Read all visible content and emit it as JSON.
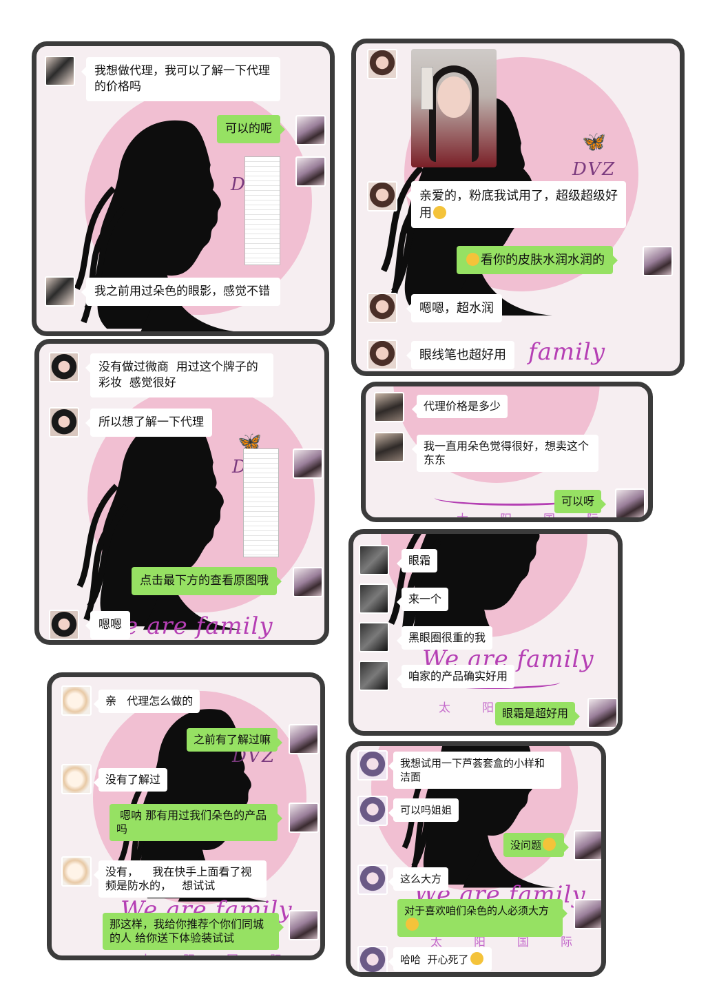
{
  "panel1": {
    "msg1": "我想做代理，我可以了解一下代理的价格吗",
    "reply1": "可以的呢",
    "msg2": "我之前用过朵色的眼影，感觉不错",
    "logo": "DVZ"
  },
  "panel2": {
    "msg1": "亲爱的，粉底我试用了，超级超级好用",
    "reply1": "看你的皮肤水润水润的",
    "msg2": "嗯嗯，超水润",
    "msg3": "眼线笔也超好用",
    "watermark": "family",
    "logo": "DVZ"
  },
  "panel3": {
    "msg1": "没有做过微商  用过这个牌子的彩妆  感觉很好",
    "msg2": "所以想了解一下代理",
    "reply1": "点击最下方的查看原图哦",
    "msg3": "嗯嗯",
    "watermark": "We are family",
    "logo": "D"
  },
  "panel4": {
    "msg1": "代理价格是多少",
    "msg2": "我一直用朵色觉得很好，想卖这个东东",
    "reply1": "可以呀",
    "watermark_cn": "太阳国际"
  },
  "panel5": {
    "msg1": "眼霜",
    "msg2": "来一个",
    "msg3": "黑眼圈很重的我",
    "msg4": "咱家的产品确实好用",
    "reply1": "眼霜是超好用",
    "watermark": "We are family",
    "watermark_cn": "太阳"
  },
  "panel6": {
    "msg1": "亲   代理怎么做的",
    "reply1": "之前有了解过嘛",
    "msg2": "没有了解过",
    "reply2": " 嗯呐 那有用过我们朵色的产品吗",
    "msg3": "没有，    我在快手上面看了视频是防水的，   想试试",
    "reply3": "那这样，我给你推荐个你们同城的人 给你送下体验装试试",
    "watermark": "We are family",
    "watermark_cn": "太阳国际",
    "logo": "DVZ"
  },
  "panel7": {
    "msg1": "我想试用一下芦荟套盒的小样和洁面",
    "msg2": "可以吗姐姐",
    "reply1": "没问题",
    "msg3": "这么大方",
    "reply2": "对于喜欢咱们朵色的人必须大方",
    "msg4": "哈哈  开心死了",
    "watermark": "We are family",
    "watermark_cn": "太阳国际"
  },
  "icons": [
    "butterfly-icon",
    "smile-emoji-icon",
    "crying-emoji-icon",
    "laugh-emoji-icon"
  ]
}
